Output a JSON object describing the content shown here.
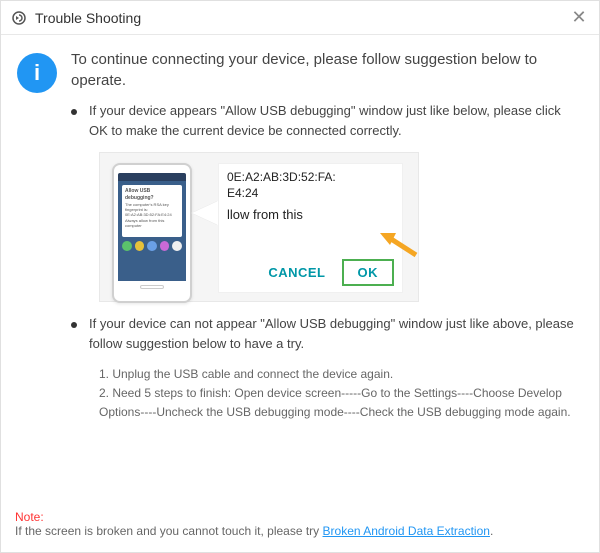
{
  "titlebar": {
    "title": "Trouble Shooting",
    "close": "✕"
  },
  "info_icon_glyph": "i",
  "intro": "To continue connecting your device, please follow suggestion below to operate.",
  "point1": "If your device appears \"Allow USB debugging\" window just like below, please click OK to make the current device  be connected correctly.",
  "illustration": {
    "phone_dialog_title": "Allow USB debugging?",
    "phone_dialog_text": "The computer's RSA key fingerprint is: 0E:A2:AB:3D:52:FA:E4:24 Always allow from this computer",
    "mac_line1": "0E:A2:AB:3D:52:FA:",
    "mac_line2": "E4:24",
    "allow_from": "llow from this",
    "cancel": "CANCEL",
    "ok": "OK"
  },
  "point2": "If your device can not appear \"Allow USB debugging\" window just like above, please follow suggestion below to have a try.",
  "steps": {
    "s1": "1. Unplug the USB cable and connect the device again.",
    "s2": "2. Need 5 steps to finish: Open device screen-----Go to the Settings----Choose Develop Options----Uncheck the USB debugging mode----Check the USB debugging mode again."
  },
  "footer": {
    "note_label": "Note:",
    "note_text": "If the screen is broken and you cannot touch it, please try ",
    "link_text": "Broken Android Data Extraction",
    "period": "."
  }
}
